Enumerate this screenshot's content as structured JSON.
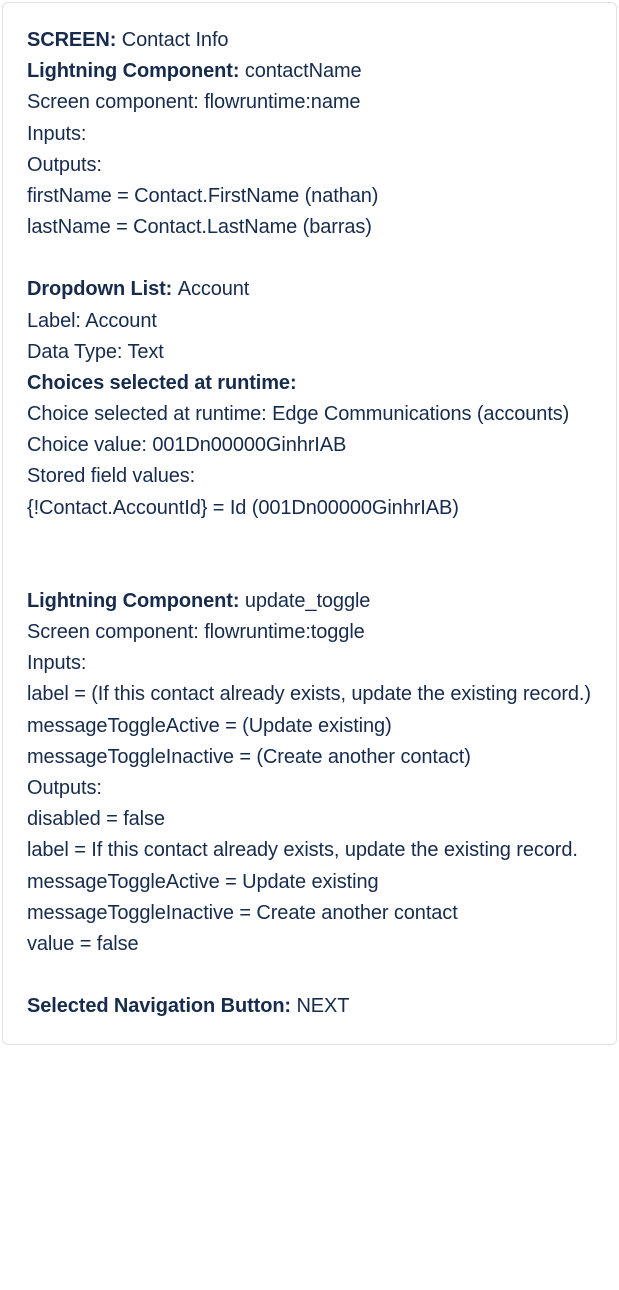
{
  "l1a": "SCREEN: ",
  "l1b": "Contact Info",
  "l2a": "Lightning Component: ",
  "l2b": "contactName",
  "l3": "Screen component: flowruntime:name",
  "l4": "Inputs:",
  "l5": "Outputs:",
  "l6": "firstName = Contact.FirstName (nathan)",
  "l7": "lastName = Contact.LastName (barras)",
  "l8a": "Dropdown List: ",
  "l8b": "Account",
  "l9": "Label: Account",
  "l10": "Data Type: Text",
  "l11a": "Choices selected at runtime:",
  "l12": "Choice selected at runtime: Edge Communications (accounts)",
  "l13": "Choice value: 001Dn00000GinhrIAB",
  "l14": "Stored field values:",
  "l15": "{!Contact.AccountId} = Id (001Dn00000GinhrIAB)",
  "l16a": "Lightning Component: ",
  "l16b": "update_toggle",
  "l17": "Screen component: flowruntime:toggle",
  "l18": "Inputs:",
  "l19": "label = (If this contact already exists, update the existing record.)",
  "l20": "messageToggleActive = (Update existing)",
  "l21": "messageToggleInactive = (Create another contact)",
  "l22": "Outputs:",
  "l23": "disabled = false",
  "l24": "label = If this contact already exists, update the existing record.",
  "l25": "messageToggleActive = Update existing",
  "l26": "messageToggleInactive = Create another contact",
  "l27": "value = false",
  "l28a": "Selected Navigation Button: ",
  "l28b": "NEXT"
}
